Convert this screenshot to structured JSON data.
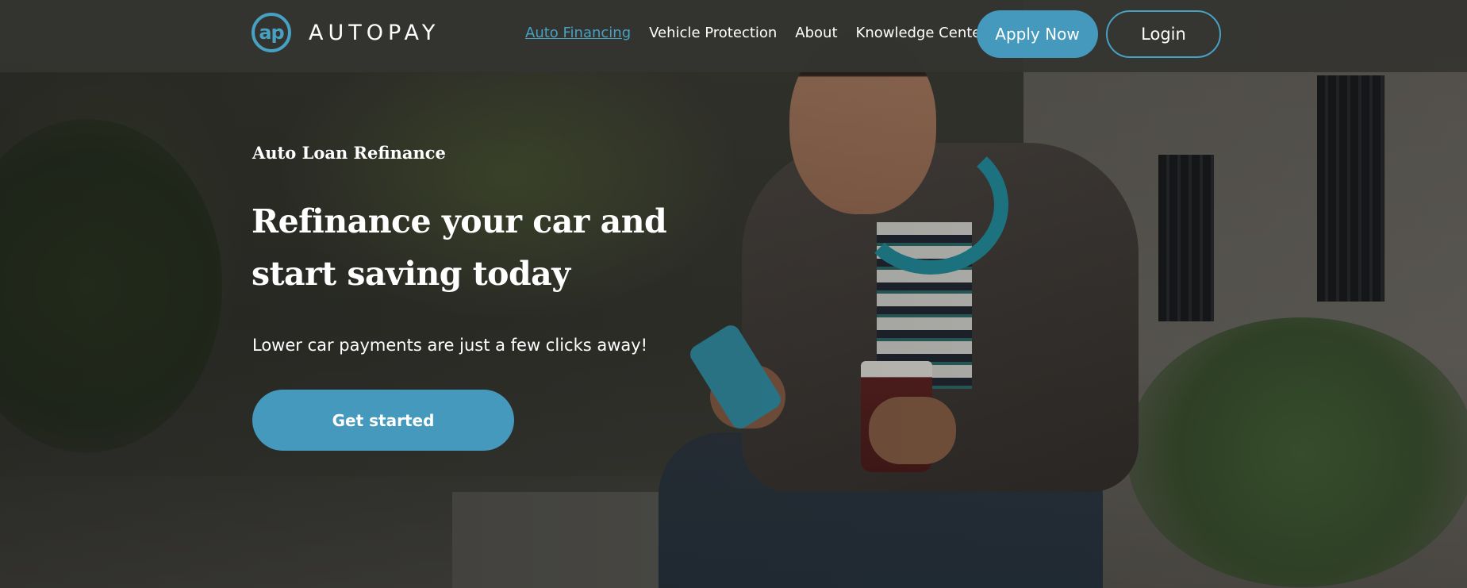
{
  "brand": {
    "logo_mark": "ap",
    "name": "AUTOPAY",
    "accent_color": "#4499bc"
  },
  "nav": {
    "links": [
      {
        "label": "Auto Financing",
        "active": true
      },
      {
        "label": "Vehicle Protection",
        "active": false
      },
      {
        "label": "About",
        "active": false
      },
      {
        "label": "Knowledge Center",
        "active": false
      }
    ],
    "apply_label": "Apply Now",
    "login_label": "Login"
  },
  "hero": {
    "eyebrow": "Auto Loan Refinance",
    "headline_line1": "Refinance your car and",
    "headline_line2": "start saving today",
    "subtext": "Lower car payments are just a few clicks away!",
    "cta_label": "Get started"
  }
}
